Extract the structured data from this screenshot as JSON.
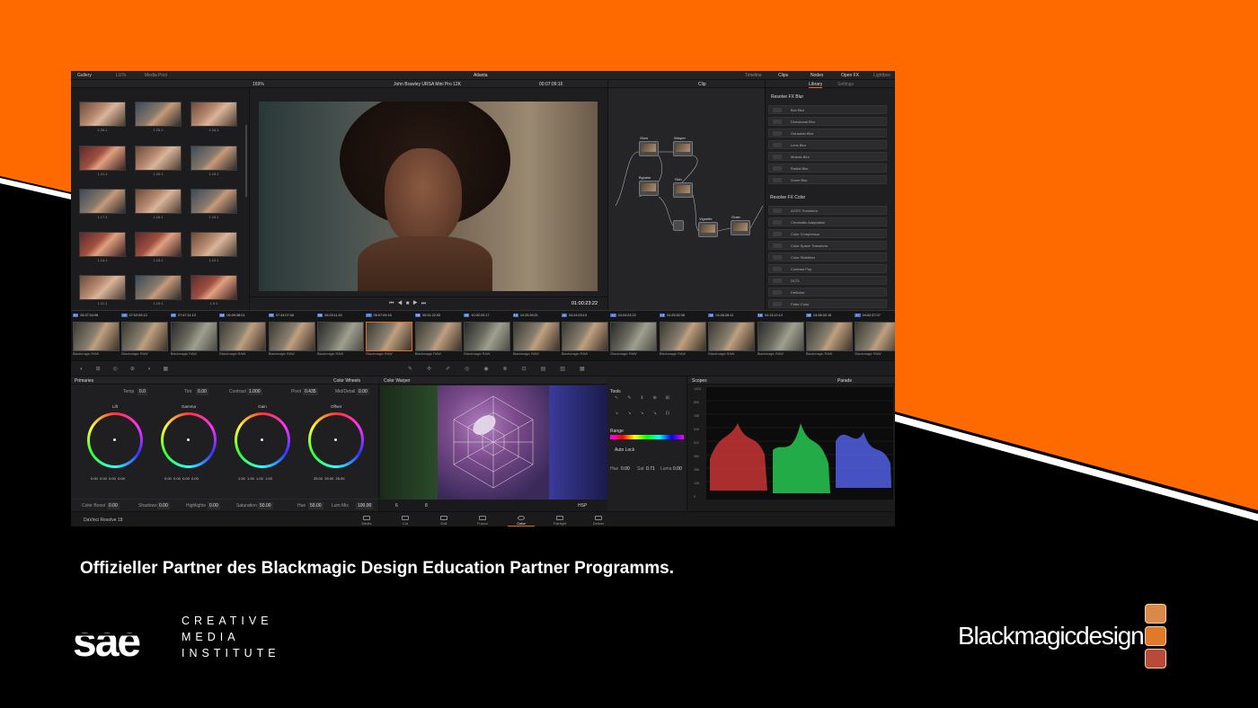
{
  "app": {
    "title": "Atlanta",
    "brand_orange": "#ff6a00"
  },
  "topbar": {
    "gallery": "Gallery",
    "luts": "LUTs",
    "media_pool": "Media Pool",
    "timeline": "Timeline",
    "clips": "Clips",
    "nodes": "Nodes",
    "open_fx": "Open FX",
    "lightbox": "Lightbox"
  },
  "viewer": {
    "zoom": "169%",
    "clip_name": "John Brawley URSA Mini Pro 12K",
    "timecode_top": "00:07:09:16",
    "timecode": "01:00:23:22",
    "node_mode": "Clip"
  },
  "gallery": {
    "thumbs": [
      "1.26.1",
      "1.25.1",
      "1.24.1",
      "1.21.1",
      "1.20.1",
      "1.19.1",
      "1.17.1",
      "1.16.1",
      "1.15.1",
      "1.14.1",
      "1.13.1",
      "1.12.1",
      "1.11.1",
      "1.10.1",
      "1.9.1"
    ]
  },
  "nodes": {
    "labels": [
      "Glow",
      "Warper",
      "Bypass",
      "Skin",
      "Vignette",
      "Grain"
    ]
  },
  "library": {
    "tab_library": "Library",
    "tab_settings": "Settings",
    "section_blur": "Resolve FX Blur",
    "blur_items": [
      "Box Blur",
      "Directional Blur",
      "Gaussian Blur",
      "Lens Blur",
      "Mosaic Blur",
      "Radial Blur",
      "Zoom Blur"
    ],
    "section_color": "Resolve FX Color",
    "color_items": [
      "ACES Transform",
      "Chromatic Adaptation",
      "Color Compressor",
      "Color Space Transform",
      "Color Stabilizer",
      "Contrast Pop",
      "DCTL",
      "Deflicker",
      "False Color"
    ]
  },
  "timeline": {
    "clips": [
      {
        "n": "01",
        "tc": "06:37:04:08"
      },
      {
        "n": "02",
        "tc": "07:02:09:12"
      },
      {
        "n": "03",
        "tc": "07:47:11:13"
      },
      {
        "n": "04",
        "tc": "06:09:38:01"
      },
      {
        "n": "05",
        "tc": "07:34:07:08"
      },
      {
        "n": "06",
        "tc": "06:29:11:01"
      },
      {
        "n": "07",
        "tc": "06:07:09:16"
      },
      {
        "n": "08",
        "tc": "05:31:22:00"
      },
      {
        "n": "09",
        "tc": "10:02:20:17"
      },
      {
        "n": "10",
        "tc": "10:25:39:21"
      },
      {
        "n": "11",
        "tc": "04:24:03:13"
      },
      {
        "n": "12",
        "tc": "04:24:23:22"
      },
      {
        "n": "13",
        "tc": "04:25:52:06"
      },
      {
        "n": "14",
        "tc": "04:26:28:11"
      },
      {
        "n": "15",
        "tc": "04:13:12:14"
      },
      {
        "n": "16",
        "tc": "04:56:02:15"
      },
      {
        "n": "17",
        "tc": "04:52:37:07"
      }
    ],
    "codec": "Blackmagic RAW"
  },
  "primaries": {
    "title": "Primaries",
    "mode": "Color Wheels",
    "temp_label": "Temp",
    "temp": "0.0",
    "tint_label": "Tint",
    "tint": "0.00",
    "contrast_label": "Contrast",
    "contrast": "1.000",
    "pivot_label": "Pivot",
    "pivot": "0.435",
    "middetail_label": "Mid/Detail",
    "middetail": "0.00",
    "wheels": [
      {
        "name": "Lift",
        "vals": [
          "0.00",
          "0.00",
          "0.00",
          "0.00"
        ]
      },
      {
        "name": "Gamma",
        "vals": [
          "0.00",
          "0.00",
          "0.00",
          "0.00"
        ]
      },
      {
        "name": "Gain",
        "vals": [
          "1.00",
          "1.00",
          "1.00",
          "1.00"
        ]
      },
      {
        "name": "Offset",
        "vals": [
          "25.00",
          "25.00",
          "25.00",
          ""
        ]
      }
    ],
    "colorboost_label": "Color Boost",
    "colorboost": "0.00",
    "shadows_label": "Shadows",
    "shadows": "0.00",
    "highlights_label": "Highlights",
    "highlights": "0.00",
    "saturation_label": "Saturation",
    "saturation": "50.00",
    "hue_label": "Hue",
    "hue": "50.00",
    "lummix_label": "Lum Mix",
    "lummix": "100.00"
  },
  "warper": {
    "title": "Color Warper",
    "tools_label": "Tools",
    "range_label": "Range",
    "autolock_label": "Auto Lock",
    "hue_label": "Hue",
    "hue": "0.00",
    "sat_label": "Sat",
    "sat": "0.71",
    "luma_label": "Luma",
    "luma": "0.00",
    "mode": "HSP",
    "b1": "6",
    "b2": "8"
  },
  "scopes": {
    "title": "Scopes",
    "mode": "Parade",
    "ticks": [
      "1023",
      "896",
      "768",
      "640",
      "512",
      "384",
      "256",
      "128",
      "0"
    ]
  },
  "bottom_nav": {
    "product": "DaVinci Resolve 18",
    "pages": [
      "Media",
      "Cut",
      "Edit",
      "Fusion",
      "Color",
      "Fairlight",
      "Deliver"
    ]
  },
  "caption": "Offizieller Partner des Blackmagic Design Education Partner Programms.",
  "sae": {
    "logo_text": "sae",
    "line1": "CREATIVE",
    "line2": "MEDIA",
    "line3": "INSTITUTE"
  },
  "bmd": {
    "name": "Blackmagicdesign",
    "colors": [
      "#d98a4a",
      "#e07a2a",
      "#b84a3a"
    ]
  }
}
